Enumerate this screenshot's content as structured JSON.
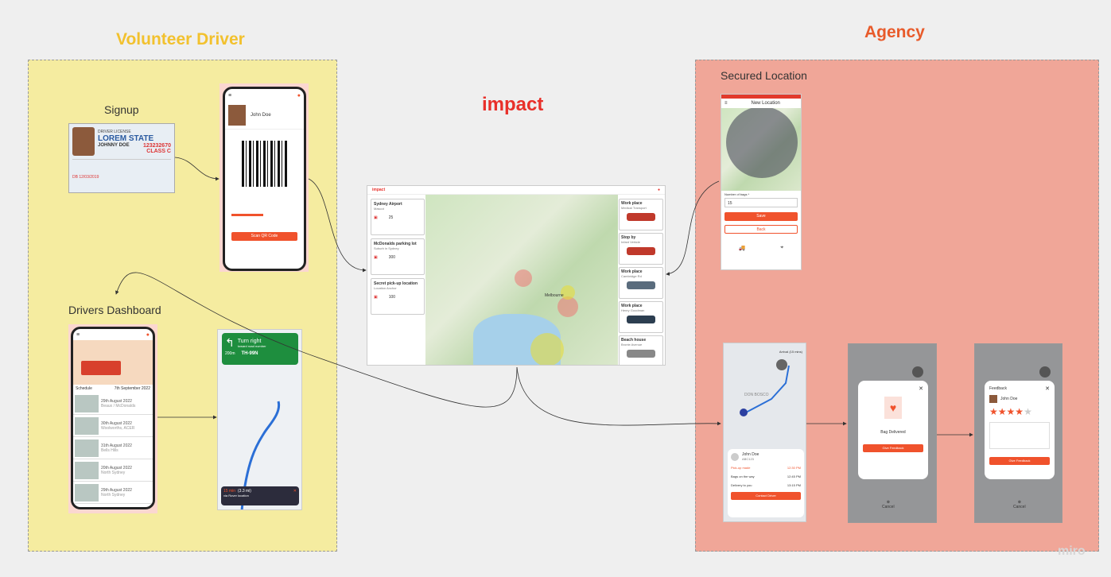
{
  "volunteer": {
    "title": "Volunteer Driver",
    "signup_label": "Signup",
    "dashboard_label": "Drivers Dashboard",
    "license": {
      "header": "DRIVER LICENSE",
      "state": "LOREM STATE",
      "name": "JOHNNY DOE",
      "number": "123232670",
      "class": "CLASS C",
      "footer": "DB 12/03/2019"
    },
    "profile_phone": {
      "name": "John Doe",
      "action": "Scan QR Code"
    },
    "dashboard_phone": {
      "date_left": "Schedule",
      "date_right": "7th September 2022",
      "items": [
        {
          "date": "29th August 2022",
          "place": "Beaux / McDonalds"
        },
        {
          "date": "30th August 2022",
          "place": "Woolworths, ACER"
        },
        {
          "date": "31th August 2022",
          "place": "Bells Hills"
        },
        {
          "date": "20th August 2022",
          "place": "North Sydney"
        },
        {
          "date": "29th August 2022",
          "place": "North Sydney"
        }
      ]
    },
    "nav_phone": {
      "instruction": "Turn right",
      "sub": "toward road number",
      "distance": "200m",
      "road": "TH-99N",
      "eta_min": "15 min",
      "eta_km": "(3.3 mi)",
      "eta_sub": "via Rover location"
    }
  },
  "center": {
    "logo": "impact",
    "dashboard": {
      "locations": [
        {
          "name": "Sydney Airport",
          "sub": "Mascot",
          "count": "25"
        },
        {
          "name": "McDonalds parking lot",
          "sub": "Suburb in Sydney",
          "count": "300"
        },
        {
          "name": "Secret pick-up location",
          "sub": "Location Anchor",
          "count": "100"
        }
      ],
      "cars": [
        {
          "name": "Work place",
          "sub": "Medical Transport"
        },
        {
          "name": "Stop by",
          "sub": "Infant Vehicle"
        },
        {
          "name": "Work place",
          "sub": "Cambridge Rd"
        },
        {
          "name": "Work place",
          "sub": "Henry Goodman"
        },
        {
          "name": "Beach house",
          "sub": "Bronte Avenue"
        }
      ],
      "map_label": "Melbourne"
    }
  },
  "agency": {
    "title": "Agency",
    "secured_label": "Secured Location",
    "new_location": {
      "title": "New Location",
      "field_label": "Number of bags *",
      "field_value": "15",
      "save": "Save",
      "back": "Back"
    },
    "tracking": {
      "arrival": "Arrival (15 mins)",
      "district": "DON BOSCO",
      "driver_name": "John Doe",
      "driver_plate": "ABC123",
      "steps": [
        {
          "label": "Pick-up made",
          "time": "12:30 PM"
        },
        {
          "label": "Bags on the way",
          "time": "12:45 PM"
        },
        {
          "label": "Delivery to you",
          "time": "13:15 PM"
        }
      ],
      "contact": "Contact Driver"
    },
    "delivered": {
      "title": "Bag Delivered",
      "button": "Give Feedback",
      "cancel": "Cancel"
    },
    "feedback": {
      "title": "Feedback",
      "name": "John Doe",
      "button": "Give Feedback",
      "cancel": "Cancel"
    }
  },
  "watermark": "miro",
  "colors": {
    "accent": "#f0522c",
    "yellow_title": "#f2c12e",
    "agency_title": "#e85a2a"
  }
}
